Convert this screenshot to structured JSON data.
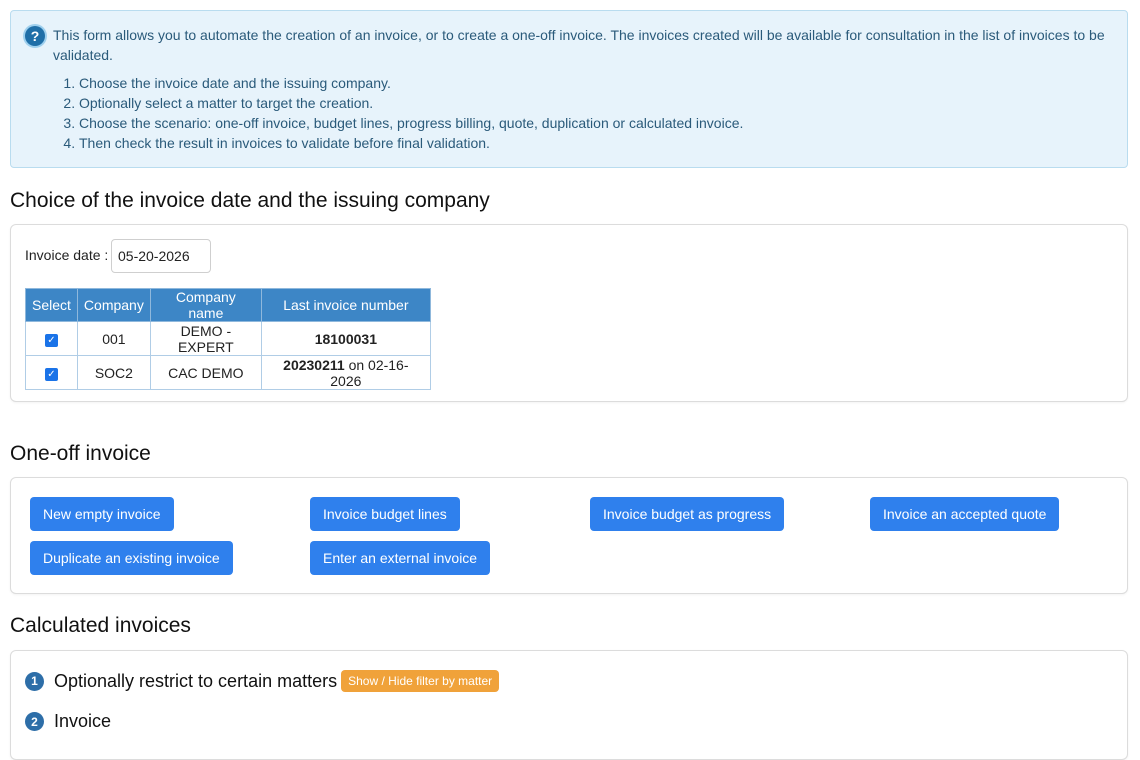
{
  "info": {
    "text": "This form allows you to automate the creation of an invoice, or to create a one-off invoice. The invoices created will be available for consultation in the list of invoices to be validated.",
    "steps": [
      "Choose the invoice date and the issuing company.",
      "Optionally select a matter to target the creation.",
      "Choose the scenario: one-off invoice, budget lines, progress billing, quote, duplication or calculated invoice.",
      "Then check the result in invoices to validate before final validation."
    ],
    "icon": "help-icon"
  },
  "section_date": {
    "title": "Choice of the invoice date and the issuing company",
    "date_label": "Invoice date :",
    "date_value": "05-20-2026",
    "columns": [
      "Select",
      "Company",
      "Company name",
      "Last invoice number"
    ],
    "rows": [
      {
        "selected": true,
        "company": "001",
        "name": "DEMO - EXPERT",
        "last_number": "18100031",
        "last_suffix": ""
      },
      {
        "selected": true,
        "company": "SOC2",
        "name": "CAC DEMO",
        "last_number": "20230211",
        "last_suffix": " on 02-16-2026"
      }
    ]
  },
  "section_oneoff": {
    "title": "One-off invoice",
    "buttons": [
      "New empty invoice",
      "Invoice budget lines",
      "Invoice budget as progress",
      "Invoice an accepted quote",
      "Duplicate an existing invoice",
      "Enter an external invoice"
    ]
  },
  "section_calc": {
    "title": "Calculated invoices",
    "step1_num": "1",
    "step1_label": "Optionally restrict to certain matters",
    "toggle_label": "Show / Hide filter by matter",
    "step2_num": "2",
    "step2_label": "Invoice"
  },
  "colors": {
    "info_bg": "#e7f3fb",
    "header_blue": "#3d86c6",
    "button_blue": "#2f80ed",
    "toggle_orange": "#f0a23a",
    "step_badge": "#2d6ea8"
  }
}
